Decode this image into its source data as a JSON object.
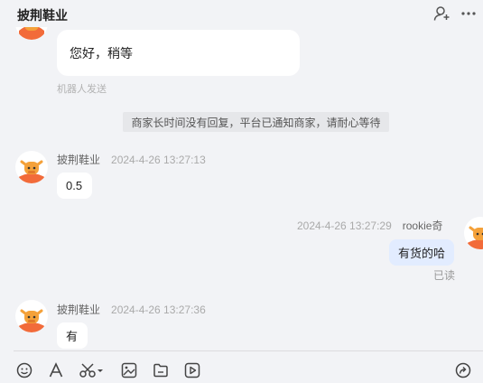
{
  "header": {
    "title": "披荆鞋业",
    "add_user_icon": "add-user-icon",
    "more_icon": "more-icon"
  },
  "messages": {
    "robot_reply": {
      "text": "您好，稍等",
      "note": "机器人发送"
    },
    "system_notice": "商家长时间没有回复，平台已通知商家，请耐心等待",
    "msg1": {
      "sender": "披荆鞋业",
      "time": "2024-4-26 13:27:13",
      "text": "0.5"
    },
    "msg2": {
      "sender": "rookie奇",
      "time": "2024-4-26 13:27:29",
      "text": "有货的哈",
      "status": "已读"
    },
    "msg3": {
      "sender": "披荆鞋业",
      "time": "2024-4-26 13:27:36",
      "text": "有"
    }
  },
  "toolbar": {
    "icons": [
      "emoji-icon",
      "font-icon",
      "scissors-icon",
      "image-icon",
      "folder-icon",
      "video-icon",
      "share-icon"
    ]
  },
  "colors": {
    "background": "#f2f3f6",
    "self_bubble": "#e2ecff",
    "other_bubble": "#ffffff",
    "avatar_orange": "#f26b3a"
  }
}
